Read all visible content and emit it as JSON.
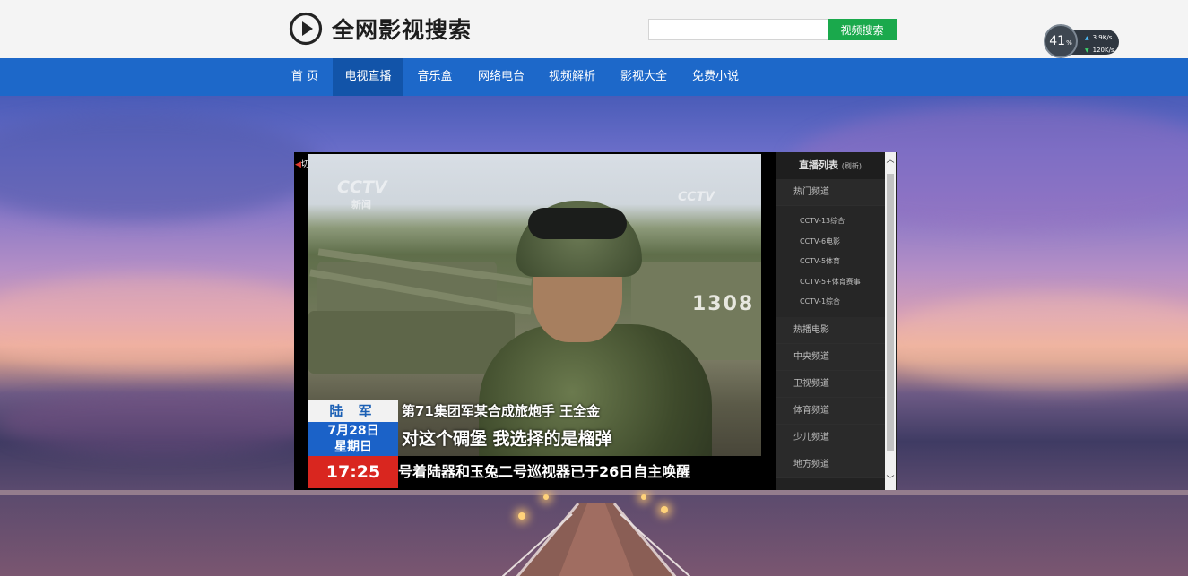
{
  "site": {
    "title": "全网影视搜索"
  },
  "search": {
    "placeholder": "",
    "value": "",
    "button_label": "视频搜索"
  },
  "speed_widget": {
    "percent": "41",
    "percent_unit": "%",
    "upload": "3.9",
    "upload_unit": "K/s",
    "download": "120",
    "download_unit": "K/s"
  },
  "nav": {
    "items": [
      {
        "label": "首 页"
      },
      {
        "label": "电视直播",
        "active": true
      },
      {
        "label": "音乐盒"
      },
      {
        "label": "网络电台"
      },
      {
        "label": "视频解析"
      },
      {
        "label": "影视大全"
      },
      {
        "label": "免费小说"
      }
    ]
  },
  "player": {
    "switch_label": "切换",
    "video": {
      "logo_left": "CCTV",
      "logo_left_sub": "新闻",
      "logo_right": "CCTV",
      "tank_number": "1308",
      "branch": "陆 军",
      "date_line1": "7月28日",
      "date_line2": "星期日",
      "time": "17:25",
      "caption1": "第71集团军某合成旅炮手 王全金",
      "caption2": "对这个碉堡 我选择的是榴弹",
      "ticker": "号着陆器和玉兔二号巡视器已于26日自主唤醒"
    },
    "playlist": {
      "title": "直播列表",
      "refresh": "(刷新)",
      "groups": [
        {
          "label": "热门频道",
          "channels": [
            "CCTV-13综合",
            "CCTV-6电影",
            "CCTV-5体育",
            "CCTV-5+体育赛事",
            "CCTV-1综合"
          ]
        },
        {
          "label": "热播电影"
        },
        {
          "label": "中央频道"
        },
        {
          "label": "卫视频道"
        },
        {
          "label": "体育频道"
        },
        {
          "label": "少儿频道"
        },
        {
          "label": "地方频道"
        }
      ]
    }
  },
  "colors": {
    "nav_bg": "#1d68c9",
    "nav_active": "#1254a9",
    "search_btn": "#1aa94c",
    "ticker_red": "#d9261f",
    "date_blue": "#1b62c8"
  }
}
